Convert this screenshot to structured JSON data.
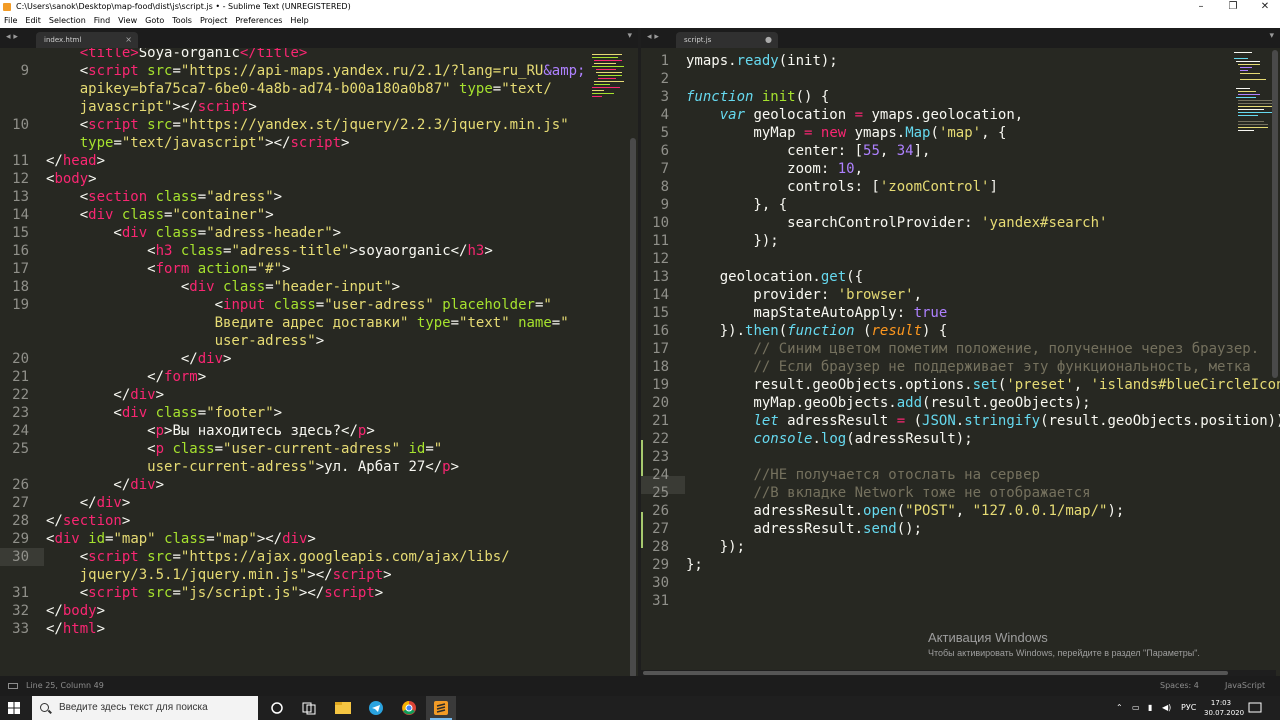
{
  "window": {
    "title": "C:\\Users\\sanok\\Desktop\\map-food\\dist\\js\\script.js • - Sublime Text (UNREGISTERED)",
    "minimize": "–",
    "maximize": "❐",
    "close": "✕"
  },
  "menu": [
    "File",
    "Edit",
    "Selection",
    "Find",
    "View",
    "Goto",
    "Tools",
    "Project",
    "Preferences",
    "Help"
  ],
  "panes": {
    "left": {
      "tab": "index.html",
      "nav": "◂ ▸",
      "close": "×",
      "dropdown": "▾"
    },
    "right": {
      "tab": "script.js",
      "nav": "◂ ▸",
      "close": "●",
      "dropdown": "▾"
    }
  },
  "left_lines": [
    {
      "n": "",
      "h": "    <span class=t>&lt;title&gt;</span>Soya-organic<span class=t>&lt;/title&gt;</span>"
    },
    {
      "n": "9",
      "h": "    <span class=w>&lt;</span><span class=t>script</span> <span class=a>src</span>=<span class=s>\"https://api-maps.yandex.ru/2.1/?lang=ru_RU</span><span class=n>&amp;amp;</span>"
    },
    {
      "n": "",
      "h": "    <span class=s>apikey=bfa75ca7-6be0-4a8b-ad74-b00a180a0b87\"</span> <span class=a>type</span>=<span class=s>\"text/</span>"
    },
    {
      "n": "",
      "h": "    <span class=s>javascript\"</span>&gt;&lt;/<span class=t>script</span>&gt;"
    },
    {
      "n": "10",
      "h": "    &lt;<span class=t>script</span> <span class=a>src</span>=<span class=s>\"https://yandex.st/jquery/2.2.3/jquery.min.js\"</span>"
    },
    {
      "n": "",
      "h": "    <span class=a>type</span>=<span class=s>\"text/javascript\"</span>&gt;&lt;/<span class=t>script</span>&gt;"
    },
    {
      "n": "11",
      "h": "&lt;/<span class=t>head</span>&gt;"
    },
    {
      "n": "12",
      "h": "&lt;<span class=t>body</span>&gt;"
    },
    {
      "n": "13",
      "h": "    &lt;<span class=t>section</span> <span class=a>class</span>=<span class=s>\"adress\"</span>&gt;"
    },
    {
      "n": "14",
      "h": "    &lt;<span class=t>div</span> <span class=a>class</span>=<span class=s>\"container\"</span>&gt;"
    },
    {
      "n": "15",
      "h": "        &lt;<span class=t>div</span> <span class=a>class</span>=<span class=s>\"adress-header\"</span>&gt;"
    },
    {
      "n": "16",
      "h": "            &lt;<span class=t>h3</span> <span class=a>class</span>=<span class=s>\"adress-title\"</span>&gt;soyaorganic&lt;/<span class=t>h3</span>&gt;"
    },
    {
      "n": "17",
      "h": "            &lt;<span class=t>form</span> <span class=a>action</span>=<span class=s>\"#\"</span>&gt;"
    },
    {
      "n": "18",
      "h": "                &lt;<span class=t>div</span> <span class=a>class</span>=<span class=s>\"header-input\"</span>&gt;"
    },
    {
      "n": "19",
      "h": "                    &lt;<span class=t>input</span> <span class=a>class</span>=<span class=s>\"user-adress\"</span> <span class=a>placeholder</span>=<span class=s>\"</span>"
    },
    {
      "n": "",
      "h": "                    <span class=s>Введите адрес доставки\"</span> <span class=a>type</span>=<span class=s>\"text\"</span> <span class=a>name</span>=<span class=s>\"</span>"
    },
    {
      "n": "",
      "h": "                    <span class=s>user-adress\"</span>&gt;"
    },
    {
      "n": "20",
      "h": "                &lt;/<span class=t>div</span>&gt;"
    },
    {
      "n": "21",
      "h": "            &lt;/<span class=t>form</span>&gt;"
    },
    {
      "n": "22",
      "h": "        &lt;/<span class=t>div</span>&gt;"
    },
    {
      "n": "23",
      "h": "        &lt;<span class=t>div</span> <span class=a>class</span>=<span class=s>\"footer\"</span>&gt;"
    },
    {
      "n": "24",
      "h": "            &lt;<span class=t>p</span>&gt;Вы находитесь здесь?&lt;/<span class=t>p</span>&gt;"
    },
    {
      "n": "25",
      "h": "            &lt;<span class=t>p</span> <span class=a>class</span>=<span class=s>\"user-current-adress\"</span> <span class=a>id</span>=<span class=s>\"</span>"
    },
    {
      "n": "",
      "h": "            <span class=s>user-current-adress\"</span>&gt;ул. Арбат 27&lt;/<span class=t>p</span>&gt;"
    },
    {
      "n": "26",
      "h": "        &lt;/<span class=t>div</span>&gt;"
    },
    {
      "n": "27",
      "h": "    &lt;/<span class=t>div</span>&gt;"
    },
    {
      "n": "28",
      "h": "&lt;/<span class=t>section</span>&gt;"
    },
    {
      "n": "29",
      "h": "&lt;<span class=t>div</span> <span class=a>id</span>=<span class=s>\"map\"</span> <span class=a>class</span>=<span class=s>\"map\"</span>&gt;&lt;/<span class=t>div</span>&gt;"
    },
    {
      "n": "30",
      "h": "    &lt;<span class=t>script</span> <span class=a>src</span>=<span class=s>\"https://ajax.googleapis.com/ajax/libs/</span>"
    },
    {
      "n": "",
      "h": "    <span class=s>jquery/3.5.1/jquery.min.js\"</span>&gt;&lt;/<span class=t>script</span>&gt;"
    },
    {
      "n": "31",
      "h": "    &lt;<span class=t>script</span> <span class=a>src</span>=<span class=s>\"js/script.js\"</span>&gt;&lt;/<span class=t>script</span>&gt;"
    },
    {
      "n": "32",
      "h": "&lt;/<span class=t>body</span>&gt;"
    },
    {
      "n": "33",
      "h": "&lt;/<span class=t>html</span>&gt;"
    }
  ],
  "right_lines": [
    {
      "n": "1",
      "h": "ymaps.<span class=f>ready</span>(init);"
    },
    {
      "n": "2",
      "h": ""
    },
    {
      "n": "3",
      "h": "<span class=k>function</span> <span class=a>init</span>() {"
    },
    {
      "n": "4",
      "h": "    <span class=k>var</span> geolocation <span class=t>=</span> ymaps.geolocation,"
    },
    {
      "n": "5",
      "h": "        myMap <span class=t>=</span> <span class=t>new</span> ymaps.<span class=f>Map</span>(<span class=s>'map'</span>, {"
    },
    {
      "n": "6",
      "h": "            center: [<span class=n>55</span>, <span class=n>34</span>],"
    },
    {
      "n": "7",
      "h": "            zoom: <span class=n>10</span>,"
    },
    {
      "n": "8",
      "h": "            controls: [<span class=s>'zoomControl'</span>]"
    },
    {
      "n": "9",
      "h": "        }, {"
    },
    {
      "n": "10",
      "h": "            searchControlProvider: <span class=s>'yandex#search'</span>"
    },
    {
      "n": "11",
      "h": "        });"
    },
    {
      "n": "12",
      "h": ""
    },
    {
      "n": "13",
      "h": "    geolocation.<span class=f>get</span>({"
    },
    {
      "n": "14",
      "h": "        provider: <span class=s>'browser'</span>,"
    },
    {
      "n": "15",
      "h": "        mapStateAutoApply: <span class=n>true</span>"
    },
    {
      "n": "16",
      "h": "    }).<span class=f>then</span>(<span class=k>function</span> (<span class=p>result</span>) {"
    },
    {
      "n": "17",
      "h": "        <span class=c>// Синим цветом пометим положение, полученное через браузер.</span>"
    },
    {
      "n": "18",
      "h": "        <span class=c>// Если браузер не поддерживает эту функциональность, метка</span>"
    },
    {
      "n": "19",
      "h": "        result.geoObjects.options.<span class=f>set</span>(<span class=s>'preset'</span>, <span class=s>'islands#blueCircleIcon'</span>);"
    },
    {
      "n": "20",
      "h": "        myMap.geoObjects.<span class=f>add</span>(result.geoObjects);"
    },
    {
      "n": "21",
      "h": "        <span class=k>let</span> adressResult <span class=t>=</span> (<span class=f>JSON</span>.<span class=f>stringify</span>(result.geoObjects.position));"
    },
    {
      "n": "22",
      "h": "        <span class=k>console</span>.<span class=f>log</span>(adressResult);"
    },
    {
      "n": "23",
      "h": ""
    },
    {
      "n": "24",
      "h": "        <span class=c>//НЕ получается отослать на сервер</span>"
    },
    {
      "n": "25",
      "h": "        <span class=c>//В вкладке Network тоже не отображается</span>"
    },
    {
      "n": "26",
      "h": "        adressResult.<span class=f>open</span>(<span class=s>\"POST\"</span>, <span class=s>\"127.0.0.1/map/\"</span>);"
    },
    {
      "n": "27",
      "h": "        adressResult.<span class=f>send</span>();"
    },
    {
      "n": "28",
      "h": "    });"
    },
    {
      "n": "29",
      "h": "};"
    },
    {
      "n": "30",
      "h": ""
    },
    {
      "n": "31",
      "h": ""
    }
  ],
  "watermark": {
    "title": "Активация Windows",
    "subtitle": "Чтобы активировать Windows, перейдите в раздел \"Параметры\"."
  },
  "status": {
    "position": "Line 25, Column 49",
    "indent": "Spaces: 4",
    "syntax": "JavaScript"
  },
  "taskbar": {
    "search_placeholder": "Введите здесь текст для поиска",
    "lang": "РУС",
    "time": "17:03",
    "date": "30.07.2020"
  },
  "colors": {
    "editor_bg": "#272822",
    "tag": "#f92672",
    "attribute": "#a6e22e",
    "string": "#e6db74",
    "number": "#ae81ff",
    "comment": "#75715e",
    "keyword": "#66d9ef"
  }
}
